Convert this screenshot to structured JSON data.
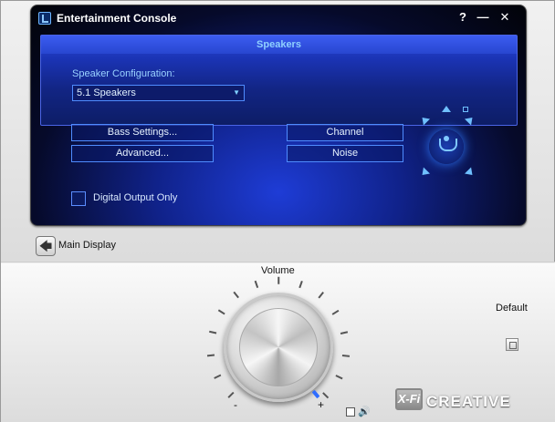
{
  "window": {
    "title": "Entertainment Console",
    "help_label": "?",
    "minimize_label": "—",
    "close_label": "✕"
  },
  "speakers": {
    "header": "Speakers",
    "config_label": "Speaker Configuration:",
    "config_value": "5.1 Speakers",
    "buttons": {
      "bass": "Bass Settings...",
      "advanced": "Advanced...",
      "channel": "Channel",
      "noise": "Noise"
    },
    "digital_output_label": "Digital Output Only"
  },
  "nav": {
    "main_display_label": "Main Display"
  },
  "volume": {
    "label": "Volume",
    "minus": "-",
    "plus": "+"
  },
  "default_label": "Default",
  "branding": {
    "xfi": "X-Fi",
    "creative": "CREATIVE"
  },
  "colors": {
    "accent": "#4f8cff",
    "panel": "#1b34b6",
    "header_text": "#8fd0ff"
  }
}
